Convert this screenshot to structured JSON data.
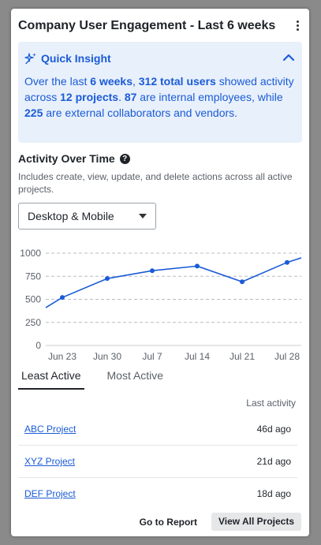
{
  "header": {
    "title": "Company User Engagement - Last 6 weeks"
  },
  "insight": {
    "title": "Quick Insight",
    "text_parts": [
      {
        "t": "Over the last ",
        "b": false
      },
      {
        "t": "6 weeks",
        "b": true
      },
      {
        "t": ", ",
        "b": false
      },
      {
        "t": "312 total users",
        "b": true
      },
      {
        "t": " showed activity across ",
        "b": false
      },
      {
        "t": "12 projects",
        "b": true
      },
      {
        "t": ". ",
        "b": false
      },
      {
        "t": "87",
        "b": true
      },
      {
        "t": " are internal employees, while ",
        "b": false
      },
      {
        "t": "225",
        "b": true
      },
      {
        "t": " are external collaborators and vendors.",
        "b": false
      }
    ]
  },
  "activity": {
    "title": "Activity Over Time",
    "description": "Includes create, view, update, and delete actions across all active projects.",
    "device_select": "Desktop & Mobile"
  },
  "chart_data": {
    "type": "line",
    "x": [
      "Jun 23",
      "Jun 30",
      "Jul 7",
      "Jul 14",
      "Jul 21",
      "Jul 28"
    ],
    "series": [
      {
        "values": [
          520,
          725,
          810,
          860,
          690,
          900
        ],
        "start": 410,
        "end": 950
      }
    ],
    "yticks": [
      0,
      250,
      500,
      750,
      1000
    ],
    "ylim": [
      0,
      1000
    ],
    "grid": true,
    "line_color": "#1a5bd7"
  },
  "tabs": [
    {
      "label": "Least Active",
      "active": true
    },
    {
      "label": "Most Active",
      "active": false
    }
  ],
  "table": {
    "column_header": "Last activity",
    "rows": [
      {
        "project": "ABC Project",
        "last_activity": "46d ago"
      },
      {
        "project": "XYZ Project",
        "last_activity": "21d ago"
      },
      {
        "project": "DEF Project",
        "last_activity": "18d ago"
      }
    ]
  },
  "footer": {
    "go_to_report": "Go to Report",
    "view_all": "View All Projects"
  }
}
